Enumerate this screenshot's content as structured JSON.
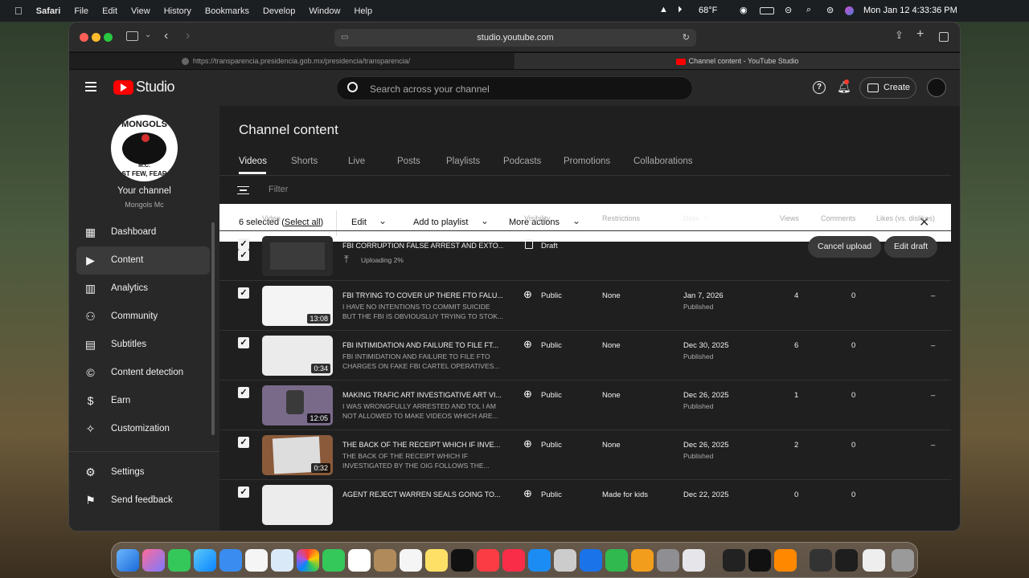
{
  "menubar": {
    "app": "Safari",
    "items": [
      "File",
      "Edit",
      "View",
      "History",
      "Bookmarks",
      "Develop",
      "Window",
      "Help"
    ],
    "temperature": "68°F",
    "datetime": "Mon Jan 12  4:33:36 PM"
  },
  "browser": {
    "url": "studio.youtube.com",
    "tabs": [
      {
        "label": "https://transparencia.presidencia.gob.mx/presidencia/transparencia/"
      },
      {
        "label": "Channel content - YouTube Studio"
      }
    ]
  },
  "studio": {
    "logo": "Studio",
    "search_placeholder": "Search across your channel",
    "create_label": "Create"
  },
  "channel": {
    "label": "Your channel",
    "name": "Mongols Mc",
    "avatar_text_top": "MONGOLS",
    "avatar_text_mid": "M.C.",
    "avatar_text_bottom": "ST FEW, FEAR"
  },
  "sidebar": {
    "items": [
      {
        "label": "Dashboard",
        "icon": "dashboard-icon"
      },
      {
        "label": "Content",
        "icon": "content-icon"
      },
      {
        "label": "Analytics",
        "icon": "analytics-icon"
      },
      {
        "label": "Community",
        "icon": "community-icon"
      },
      {
        "label": "Subtitles",
        "icon": "subtitles-icon"
      },
      {
        "label": "Content detection",
        "icon": "copyright-icon"
      },
      {
        "label": "Earn",
        "icon": "dollar-icon"
      },
      {
        "label": "Customization",
        "icon": "wand-icon"
      }
    ],
    "settings": "Settings",
    "feedback": "Send feedback"
  },
  "page": {
    "title": "Channel content",
    "tabs": [
      "Videos",
      "Shorts",
      "Live",
      "Posts",
      "Playlists",
      "Podcasts",
      "Promotions",
      "Collaborations"
    ],
    "filter_placeholder": "Filter"
  },
  "selection": {
    "count_text": "6 selected (",
    "select_all": "Select all",
    "close_paren": ")",
    "edit": "Edit",
    "add_to_playlist": "Add to playlist",
    "more_actions": "More actions"
  },
  "table": {
    "headers": {
      "video": "Video",
      "visibility": "Visibility",
      "restrictions": "Restrictions",
      "date": "Date",
      "views": "Views",
      "comments": "Comments",
      "likes": "Likes (vs. dislikes)"
    },
    "draft": {
      "title": "FBI CORRUPTION FALSE ARREST AND EXTO...",
      "upload_status": "Uploading 2%",
      "visibility": "Draft",
      "cancel": "Cancel upload",
      "edit_draft": "Edit draft"
    },
    "rows": [
      {
        "title": "FBI TRYING TO COVER UP THERE FTO FALU...",
        "desc": "I HAVE NO INTENTIONS TO COMMIT SUICIDE BUT THE FBI IS OBVIOUSLUY TRYING TO STOK...",
        "duration": "13:08",
        "visibility": "Public",
        "restrictions": "None",
        "date": "Jan 7, 2026",
        "status": "Published",
        "views": "4",
        "comments": "0",
        "likes": "–"
      },
      {
        "title": "FBI INTIMIDATION AND FAILURE TO FILE FT...",
        "desc": "FBI INTIMIDATION AND FAILURE TO FILE FTO CHARGES ON FAKE FBI CARTEL OPERATIVES...",
        "duration": "0:34",
        "visibility": "Public",
        "restrictions": "None",
        "date": "Dec 30, 2025",
        "status": "Published",
        "views": "6",
        "comments": "0",
        "likes": "–"
      },
      {
        "title": "MAKING TRAFIC ART INVESTIGATIVE ART VI...",
        "desc": "I WAS WRONGFULLY ARRESTED AND TOL I AM NOT ALLOWED TO MAKE VIDEOS WHICH ARE...",
        "duration": "12:05",
        "visibility": "Public",
        "restrictions": "None",
        "date": "Dec 26, 2025",
        "status": "Published",
        "views": "1",
        "comments": "0",
        "likes": "–"
      },
      {
        "title": "THE BACK OF THE RECEIPT WHICH IF INVE...",
        "desc": "THE BACK OF THE RECEIPT WHICH IF INVESTIGATED BY THE OIG FOLLOWS THE...",
        "duration": "0:32",
        "visibility": "Public",
        "restrictions": "None",
        "date": "Dec 26, 2025",
        "status": "Published",
        "views": "2",
        "comments": "0",
        "likes": "–"
      },
      {
        "title": "AGENT REJECT WARREN SEALS GOING TO...",
        "desc": "",
        "duration": "",
        "visibility": "Public",
        "restrictions": "Made for kids",
        "date": "Dec 22, 2025",
        "status": "",
        "views": "0",
        "comments": "0",
        "likes": ""
      }
    ]
  },
  "colors": {
    "yt_red": "#ff0000",
    "bg": "#1f1f1f",
    "panel": "#282828"
  }
}
